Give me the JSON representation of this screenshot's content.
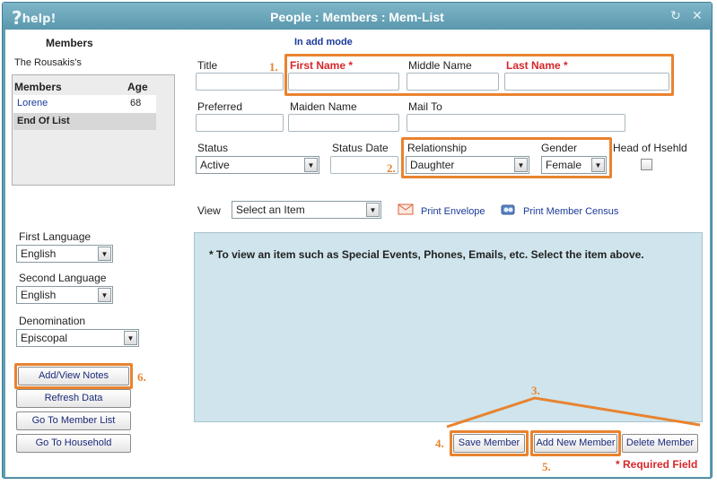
{
  "window": {
    "logo": "help!",
    "title": "People : Members : Mem-List"
  },
  "sidebar": {
    "members_heading": "Members",
    "household_name": "The Rousakis's",
    "table": {
      "col_members": "Members",
      "col_age": "Age",
      "rows": [
        {
          "name": "Lorene",
          "age": "68"
        }
      ],
      "end_label": "End Of List"
    },
    "first_language": {
      "label": "First Language",
      "value": "English"
    },
    "second_language": {
      "label": "Second Language",
      "value": "English"
    },
    "denomination": {
      "label": "Denomination",
      "value": "Episcopal"
    },
    "buttons": {
      "add_view_notes": "Add/View Notes",
      "refresh_data": "Refresh Data",
      "go_to_member_list": "Go To Member List",
      "go_to_household": "Go To Household"
    }
  },
  "form": {
    "mode": "In add mode",
    "title_label": "Title",
    "first_name_label": "First Name *",
    "middle_name_label": "Middle Name",
    "last_name_label": "Last Name *",
    "preferred_label": "Preferred",
    "maiden_name_label": "Maiden Name",
    "mail_to_label": "Mail To",
    "status": {
      "label": "Status",
      "value": "Active"
    },
    "status_date_label": "Status Date",
    "relationship": {
      "label": "Relationship",
      "value": "Daughter"
    },
    "gender": {
      "label": "Gender",
      "value": "Female"
    },
    "head_of_household_label": "Head of Hsehld",
    "view": {
      "label": "View",
      "value": "Select an Item"
    },
    "print_envelope": "Print Envelope",
    "print_member_census": "Print Member Census",
    "info_text": "* To view an item such as Special Events, Phones, Emails, etc. Select the item above.",
    "buttons": {
      "save_member": "Save Member",
      "add_new_member": "Add New Member",
      "delete_member": "Delete Member"
    },
    "required_note": "* Required Field"
  },
  "annotations": {
    "n1": "1.",
    "n2": "2.",
    "n3": "3.",
    "n4": "4.",
    "n5": "5.",
    "n6": "6."
  },
  "colors": {
    "window_frame": "#5f9eb3",
    "highlight": "#e8832f",
    "required_red": "#d8262a",
    "info_panel": "#cfe4ec",
    "link_blue": "#1a3a9a"
  }
}
